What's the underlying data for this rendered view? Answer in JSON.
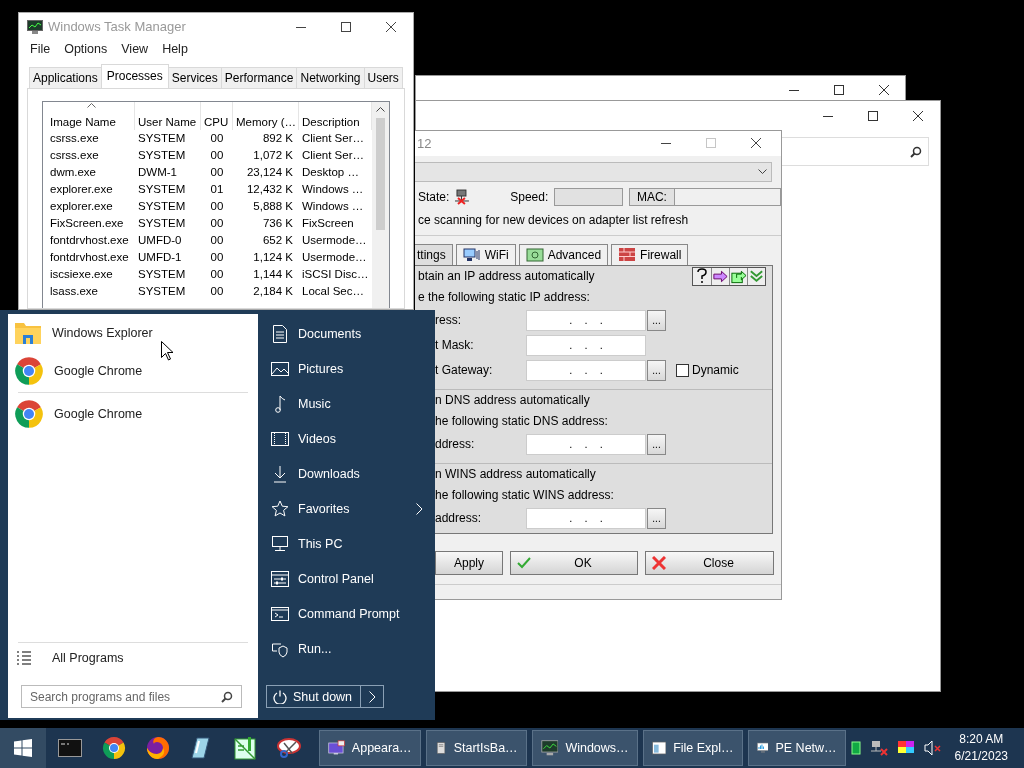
{
  "task_manager": {
    "title": "Windows Task Manager",
    "menu": [
      "File",
      "Options",
      "View",
      "Help"
    ],
    "tabs": [
      {
        "label": "Applications",
        "selected": false
      },
      {
        "label": "Processes",
        "selected": true
      },
      {
        "label": "Services",
        "selected": false
      },
      {
        "label": "Performance",
        "selected": false
      },
      {
        "label": "Networking",
        "selected": false
      },
      {
        "label": "Users",
        "selected": false
      }
    ],
    "columns": [
      {
        "label": "Image Name",
        "sorted": true
      },
      {
        "label": "User Name",
        "sorted": false
      },
      {
        "label": "CPU",
        "sorted": false
      },
      {
        "label": "Memory (…",
        "sorted": false
      },
      {
        "label": "Description",
        "sorted": false
      }
    ],
    "rows": [
      [
        "csrss.exe",
        "SYSTEM",
        "00",
        "892 K",
        "Client Ser…"
      ],
      [
        "csrss.exe",
        "SYSTEM",
        "00",
        "1,072 K",
        "Client Ser…"
      ],
      [
        "dwm.exe",
        "DWM-1",
        "00",
        "23,124 K",
        "Desktop …"
      ],
      [
        "explorer.exe",
        "SYSTEM",
        "01",
        "12,432 K",
        "Windows …"
      ],
      [
        "explorer.exe",
        "SYSTEM",
        "00",
        "5,888 K",
        "Windows …"
      ],
      [
        "FixScreen.exe",
        "SYSTEM",
        "00",
        "736 K",
        "FixScreen"
      ],
      [
        "fontdrvhost.exe",
        "UMFD-0",
        "00",
        "652 K",
        "Usermode…"
      ],
      [
        "fontdrvhost.exe",
        "UMFD-1",
        "00",
        "1,124 K",
        "Usermode…"
      ],
      [
        "iscsiexe.exe",
        "SYSTEM",
        "00",
        "1,144 K",
        "iSCSI Disc…"
      ],
      [
        "lsass.exe",
        "SYSTEM",
        "00",
        "2,184 K",
        "Local Sec…"
      ]
    ]
  },
  "network_dialog": {
    "title": "12",
    "state_label": "State:",
    "speed_label": "Speed:",
    "mac_label": "MAC:",
    "scan_option": "ce scanning for new devices on adapter list refresh",
    "tabs": [
      {
        "label": "ttings",
        "selected": true
      },
      {
        "label": "WiFi",
        "selected": false
      },
      {
        "label": "Advanced",
        "selected": false
      },
      {
        "label": "Firewall",
        "selected": false
      }
    ],
    "sections": [
      {
        "auto": "btain an IP address automatically",
        "manual": "e the following static IP address:",
        "fields": [
          {
            "label": "ress:",
            "value": ".    .    .",
            "browse": "..."
          },
          {
            "label": "t Mask:",
            "value": ".    .    ."
          },
          {
            "label": "t Gateway:",
            "value": ".    .    .",
            "browse": "...",
            "checkbox": {
              "label": "Dynamic",
              "checked": false
            }
          }
        ]
      },
      {
        "auto": "n DNS address automatically",
        "manual": "he following static DNS address:",
        "fields": [
          {
            "label": "ddress:",
            "value": ".    .    .",
            "browse": "..."
          }
        ]
      },
      {
        "auto": "n WINS address automatically",
        "manual": "he following static WINS address:",
        "fields": [
          {
            "label": "address:",
            "value": ".    .    .",
            "browse": "..."
          }
        ]
      }
    ],
    "buttons": [
      {
        "label": "Apply",
        "kind": "plain"
      },
      {
        "label": "OK",
        "kind": "ok"
      },
      {
        "label": "Close",
        "kind": "close"
      }
    ]
  },
  "start_menu": {
    "programs": [
      {
        "label": "Windows Explorer"
      },
      {
        "label": "Google Chrome"
      }
    ],
    "recent": [
      {
        "label": "Google Chrome"
      }
    ],
    "all_programs": "All Programs",
    "search": {
      "placeholder": "Search programs and files"
    },
    "places": [
      {
        "label": "Documents",
        "submenu": false
      },
      {
        "label": "Pictures",
        "submenu": false
      },
      {
        "label": "Music",
        "submenu": false
      },
      {
        "label": "Videos",
        "submenu": false
      },
      {
        "label": "Downloads",
        "submenu": false
      },
      {
        "label": "Favorites",
        "submenu": true
      },
      {
        "label": "This PC",
        "submenu": false
      },
      {
        "label": "Control Panel",
        "submenu": false
      },
      {
        "label": "Command Prompt",
        "submenu": false
      },
      {
        "label": "Run...",
        "submenu": false
      }
    ],
    "shutdown": "Shut down"
  },
  "taskbar": {
    "tasks": [
      {
        "label": "Appeara…"
      },
      {
        "label": "StartIsBa…"
      },
      {
        "label": "Windows…"
      },
      {
        "label": "File Expl…"
      },
      {
        "label": "PE Netw…"
      }
    ],
    "clock": {
      "time": "8:20 AM",
      "date": "6/21/2023"
    }
  }
}
